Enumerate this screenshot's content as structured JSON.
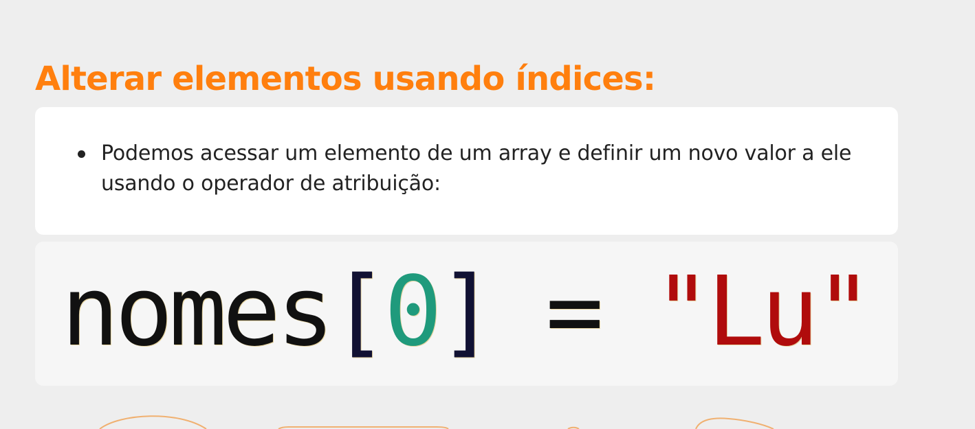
{
  "heading": {
    "text": "Alterar elementos usando índices:",
    "color": "#ff7f0e"
  },
  "content": {
    "bullets": [
      "Podemos acessar um elemento de um array e definir um novo valor a ele usando o operador de atribuição:"
    ]
  },
  "code": {
    "tokens": {
      "variable": "nomes",
      "open_bracket": "[",
      "index": "0",
      "close_bracket": "]",
      "operator": " = ",
      "string": "\"Lu\""
    },
    "colors": {
      "index": "#1f9a7c",
      "string": "#b00c0c"
    }
  }
}
